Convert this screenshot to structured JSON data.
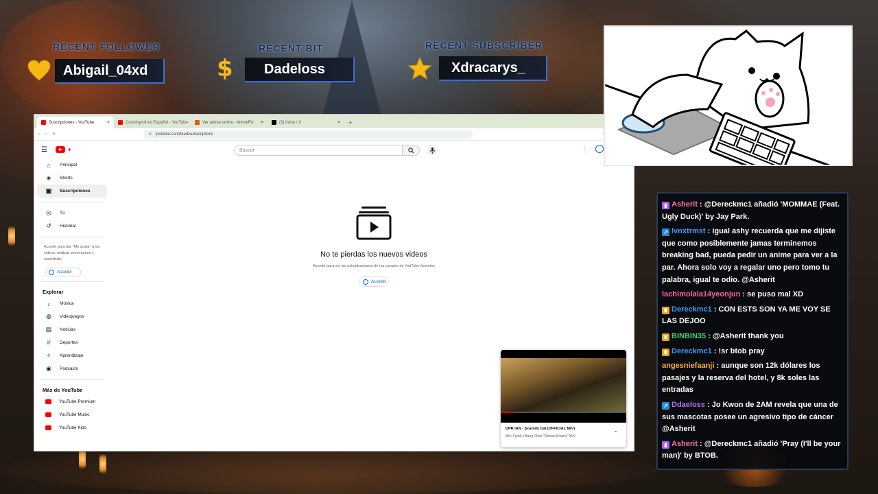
{
  "overlay": {
    "recent_follower": {
      "title": "RECENT FOLLOWER",
      "name": "Abigail_04xd"
    },
    "recent_bit": {
      "title": "RECENT BIT",
      "name": "Dadeloss"
    },
    "recent_subscriber": {
      "title": "RECENT SUBSCRIBER",
      "name": "Xdracarys_"
    }
  },
  "browser": {
    "tabs": [
      {
        "label": "Suscripciones - YouTube",
        "favicon_color": "#ff0000",
        "active": true
      },
      {
        "label": "Crunchyroll en Español - YouTube",
        "favicon_color": "#ff0000",
        "active": false
      },
      {
        "label": "Ver anime online - AnimeFlv",
        "favicon_color": "#e3591a",
        "active": false
      },
      {
        "label": "(3) Inicio / X",
        "favicon_color": "#000000",
        "active": false
      }
    ],
    "url": "youtube.com/feed/subscriptions"
  },
  "youtube": {
    "search_placeholder": "Buscar",
    "sidebar": {
      "main": [
        {
          "label": "Principal",
          "icon": "home-icon",
          "glyph": "⌂"
        },
        {
          "label": "Shorts",
          "icon": "shorts-icon",
          "glyph": "◈"
        },
        {
          "label": "Suscripciones",
          "icon": "subscriptions-icon",
          "glyph": "▣"
        }
      ],
      "you": [
        {
          "label": "Tú",
          "icon": "user-icon",
          "glyph": "◎"
        },
        {
          "label": "Historial",
          "icon": "history-icon",
          "glyph": "↺"
        }
      ],
      "signin_note": "Accede para dar \"Me gusta\" a los videos, realizar comentarios y suscribirte.",
      "signin_label": "Acceder",
      "explore_title": "Explorar",
      "explore": [
        {
          "label": "Música",
          "icon": "music-icon",
          "glyph": "♪"
        },
        {
          "label": "Videojuegos",
          "icon": "gaming-icon",
          "glyph": "◍"
        },
        {
          "label": "Noticias",
          "icon": "news-icon",
          "glyph": "▤"
        },
        {
          "label": "Deportes",
          "icon": "trophy-icon",
          "glyph": "♕"
        },
        {
          "label": "Aprendizaje",
          "icon": "learning-icon",
          "glyph": "✧"
        },
        {
          "label": "Podcasts",
          "icon": "podcast-icon",
          "glyph": "◉"
        }
      ],
      "more_title": "Más de YouTube",
      "more": [
        {
          "label": "YouTube Premium",
          "icon": "yt-premium-icon"
        },
        {
          "label": "YouTube Music",
          "icon": "yt-music-icon"
        },
        {
          "label": "YouTube Kids",
          "icon": "yt-kids-icon"
        }
      ]
    },
    "empty_state": {
      "title": "No te pierdas los nuevos videos",
      "subtitle": "Accede para ver las actualizaciones de tus canales de YouTube favoritos",
      "signin_label": "Acceder"
    },
    "miniplayer": {
      "title": "DPR IAN - Scaredy Cat (OFFICIAL M/V)",
      "subtitle": "Mix: Fendi x Bang Chan \"Roman Empire\" M/V",
      "progress": 0.1
    }
  },
  "chat": {
    "messages": [
      {
        "user": "Asherit",
        "color": "#ff6fb0",
        "badge": "mic",
        "badge_color": "#b05cff",
        "text": "@Dereckmc1 añadió 'MOMMAE (Feat. Ugly Duck)' by Jay Park."
      },
      {
        "user": "lvnxtrmst",
        "color": "#3a9bff",
        "badge": "prime",
        "badge_color": "#2a8ad8",
        "text": "igual ashy recuerda que me dijiste que como posiblemente jamas terminemos breaking bad, pueda pedir un anime para ver a la par. Ahora solo voy a regalar uno pero tomo tu palabra, igual te odio. @Asherit"
      },
      {
        "user": "lachimolala14yeonjun",
        "color": "#ff5fa8",
        "badge": "",
        "badge_color": "",
        "text": "se puso mal XD"
      },
      {
        "user": "Dereckmc1",
        "color": "#3a9bff",
        "badge": "crown",
        "badge_color": "#e8a521",
        "text": "CON ESTS SON YA ME VOY SE LAS DEJOO"
      },
      {
        "user": "BINBIN35",
        "color": "#33d17a",
        "badge": "crown",
        "badge_color": "#e8a521",
        "text": "@Asherit thank you"
      },
      {
        "user": "Dereckmc1",
        "color": "#3a9bff",
        "badge": "crown",
        "badge_color": "#e8a521",
        "text": "!sr btob pray"
      },
      {
        "user": "angesniefaanji",
        "color": "#ffb347",
        "badge": "",
        "badge_color": "",
        "text": "aunque son 12k dólares los pasajes y la reserva del hotel, y 8k soles las entradas"
      },
      {
        "user": "Ddaeloss",
        "color": "#b96cff",
        "badge": "prime",
        "badge_color": "#2a8ad8",
        "text": "Jo Kwon de 2AM revela que una de sus mascotas posee un agresivo tipo de cáncer @Asherit"
      },
      {
        "user": "Asherit",
        "color": "#ff6fb0",
        "badge": "mic",
        "badge_color": "#b05cff",
        "text": "@Dereckmc1 añadió 'Pray (I'll be your man)' by BTOB."
      }
    ]
  }
}
